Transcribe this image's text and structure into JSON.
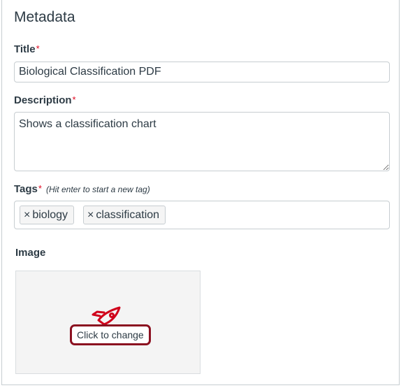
{
  "panel": {
    "heading": "Metadata"
  },
  "title_field": {
    "label": "Title",
    "required_mark": "*",
    "value": "Biological Classification PDF"
  },
  "description_field": {
    "label": "Description",
    "required_mark": "*",
    "value": "Shows a classification chart"
  },
  "tags_field": {
    "label": "Tags",
    "required_mark": "*",
    "hint": "(Hit enter to start a new tag)",
    "tags": [
      {
        "remove_icon": "×",
        "label": "biology"
      },
      {
        "remove_icon": "×",
        "label": "classification"
      }
    ]
  },
  "image_field": {
    "label": "Image",
    "icon": "rocket-icon",
    "change_label": "Click to change"
  },
  "colors": {
    "required": "#e0061f",
    "highlight_border": "#8b1020",
    "icon": "#d0021b",
    "text": "#2d3b45"
  }
}
